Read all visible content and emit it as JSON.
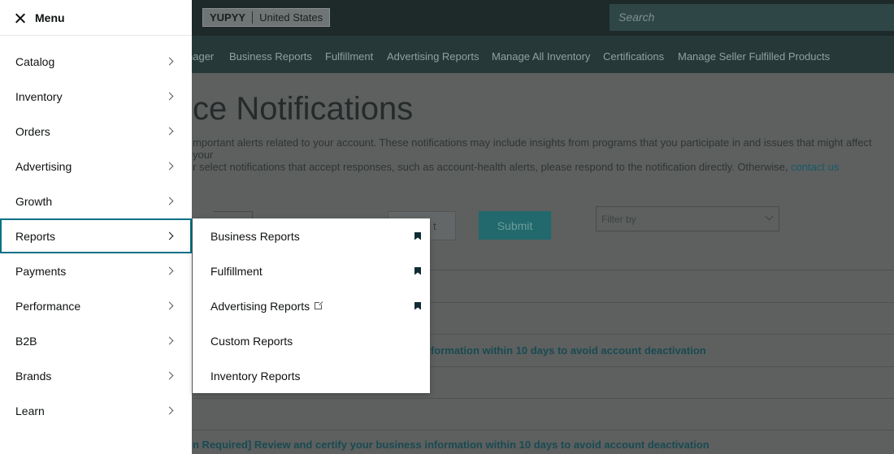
{
  "background": {
    "store": {
      "name": "YUPYY",
      "region": "United States"
    },
    "search_placeholder": "Search",
    "nav_items": [
      "nager",
      "Business Reports",
      "Fulfillment",
      "Advertising Reports",
      "Manage All Inventory",
      "Certifications",
      "Manage Seller Fulfilled Products"
    ],
    "page_title": "ce Notifications",
    "description_line1": "mportant alerts related to your account. These notifications may include insights from programs that you participate in and issues that might affect your",
    "description_line2": "r select notifications that accept responses, such as account-health alerts, please respond to the notification directly. Otherwise, ",
    "description_link": "contact us",
    "reset_label": "t",
    "submit_label": "Submit",
    "filter_placeholder": "Filter by",
    "notice1": "nformation within 10 days to avoid account deactivation",
    "notice2": "n Required] Review and certify your business information within 10 days to avoid account deactivation"
  },
  "menu": {
    "title": "Menu",
    "items": [
      {
        "label": "Catalog"
      },
      {
        "label": "Inventory"
      },
      {
        "label": "Orders"
      },
      {
        "label": "Advertising"
      },
      {
        "label": "Growth"
      },
      {
        "label": "Reports"
      },
      {
        "label": "Payments"
      },
      {
        "label": "Performance"
      },
      {
        "label": "B2B"
      },
      {
        "label": "Brands"
      },
      {
        "label": "Learn"
      }
    ],
    "active": "Reports"
  },
  "submenu": {
    "items": [
      {
        "label": "Business Reports",
        "bookmarked": true
      },
      {
        "label": "Fulfillment",
        "bookmarked": true
      },
      {
        "label": "Advertising Reports",
        "bookmarked": true,
        "external": true
      },
      {
        "label": "Custom Reports",
        "bookmarked": false
      },
      {
        "label": "Inventory Reports",
        "bookmarked": false
      }
    ]
  },
  "colors": {
    "accent": "#007185",
    "overlay": "#5d605f",
    "submit": "#21696c"
  }
}
